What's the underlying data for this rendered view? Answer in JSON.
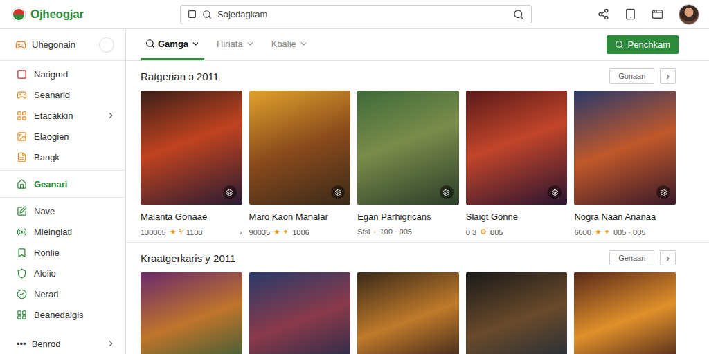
{
  "app": {
    "logo": "Ojheogjar"
  },
  "search": {
    "value": "Sajedagkam"
  },
  "sidebar": {
    "header": "Uhegonain",
    "groups": [
      [
        {
          "label": "Narigmd",
          "selected": false,
          "chevron": false
        },
        {
          "label": "Seanarid",
          "selected": false,
          "chevron": false
        },
        {
          "label": "Etacakkin",
          "selected": false,
          "chevron": true
        },
        {
          "label": "Elaogien",
          "selected": false,
          "chevron": false
        },
        {
          "label": "Bangk",
          "selected": false,
          "chevron": false
        }
      ],
      [
        {
          "label": "Geanari",
          "selected": true,
          "chevron": false
        }
      ],
      [
        {
          "label": "Nave",
          "selected": false,
          "chevron": false
        },
        {
          "label": "Mleingiati",
          "selected": false,
          "chevron": false
        },
        {
          "label": "Ronlie",
          "selected": false,
          "chevron": false
        },
        {
          "label": "Aloiio",
          "selected": false,
          "chevron": false
        },
        {
          "label": "Nerari",
          "selected": false,
          "chevron": false
        },
        {
          "label": "Beanedaigis",
          "selected": false,
          "chevron": false
        }
      ]
    ],
    "footer": {
      "dots": "•••",
      "label": "Benrod"
    }
  },
  "tabs": [
    {
      "label": "Gamga",
      "selected": true
    },
    {
      "label": "Hiriata",
      "selected": false
    },
    {
      "label": "Kbalie",
      "selected": false
    }
  ],
  "action_button": "Penchkam",
  "sections": [
    {
      "title": "Ratgerian ɔ 2011",
      "button": "Gonaan",
      "next": "›",
      "cards": [
        {
          "title": "Malanta Gonaae",
          "score": "130005",
          "badge": "★ ⅟",
          "reviews": "1108",
          "arrow": "›"
        },
        {
          "title": "Maro Kaon Manalar",
          "score": "90035",
          "badge": "★ ✦",
          "reviews": "1006",
          "arrow": ""
        },
        {
          "title": "Egan Parhigricans",
          "score": "Sfsi",
          "badge": "◦",
          "reviews": "100 · 005",
          "arrow": ""
        },
        {
          "title": "Slaigt Gonne",
          "score": "0 3",
          "badge": "⚙",
          "reviews": "005",
          "arrow": ""
        },
        {
          "title": "Nogra Naan Ananaa",
          "score": "6000",
          "badge": "★ ✦",
          "reviews": "005 · 005",
          "arrow": ""
        }
      ]
    },
    {
      "title": "Kraatgerkaris y 2011",
      "button": "Genaan",
      "next": "›",
      "cards": []
    }
  ]
}
